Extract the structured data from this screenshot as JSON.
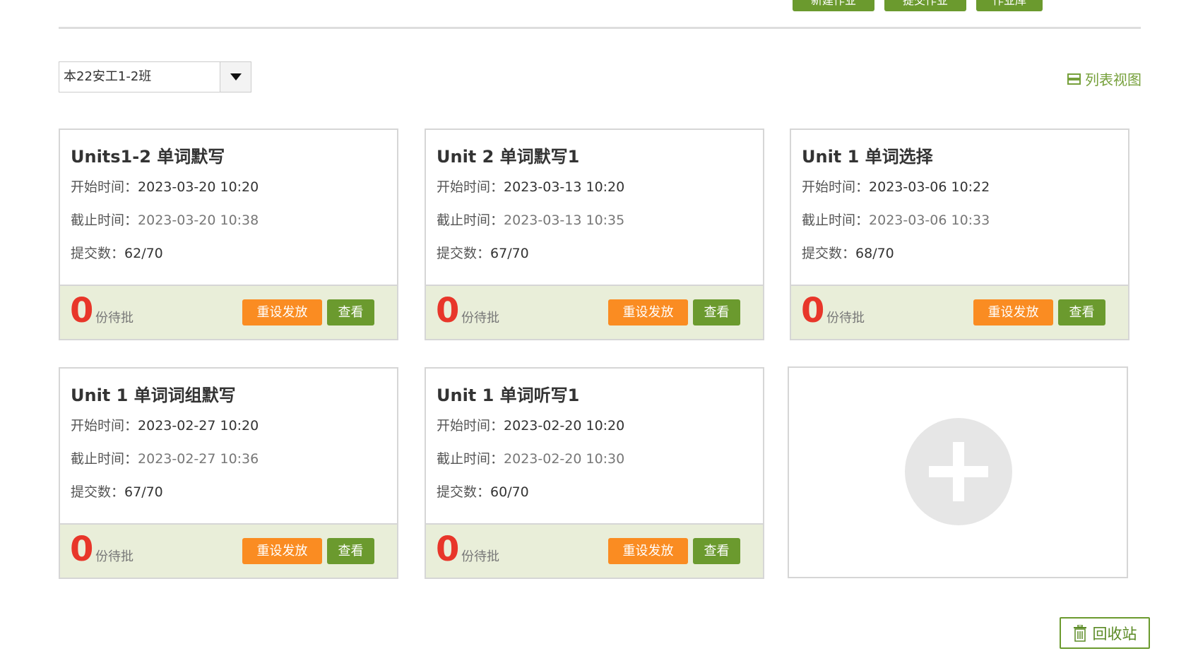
{
  "toolbar": {
    "buttons": [
      "新建作业",
      "提交作业",
      "作业库"
    ]
  },
  "class_select": {
    "value": "本22安工1-2班"
  },
  "view_toggle": {
    "label": "列表视图"
  },
  "card_labels": {
    "start": "开始时间：",
    "end": "截止时间：",
    "count": "提交数：",
    "pending": "份待批",
    "reissue": "重设发放",
    "view": "查看"
  },
  "cards": [
    {
      "title": "Units1-2 单词默写",
      "start": "2023-03-20 10:20",
      "end": "2023-03-20 10:38",
      "submitted": "62/70",
      "pending": "0"
    },
    {
      "title": "Unit 2 单词默写1",
      "start": "2023-03-13 10:20",
      "end": "2023-03-13 10:35",
      "submitted": "67/70",
      "pending": "0"
    },
    {
      "title": "Unit 1 单词选择",
      "start": "2023-03-06 10:22",
      "end": "2023-03-06 10:33",
      "submitted": "68/70",
      "pending": "0"
    },
    {
      "title": "Unit 1 单词词组默写",
      "start": "2023-02-27 10:20",
      "end": "2023-02-27 10:36",
      "submitted": "67/70",
      "pending": "0"
    },
    {
      "title": "Unit 1 单词听写1",
      "start": "2023-02-20 10:20",
      "end": "2023-02-20 10:30",
      "submitted": "60/70",
      "pending": "0"
    }
  ],
  "recycle": {
    "label": "回收站"
  },
  "colors": {
    "green": "#6b9a2e",
    "orange": "#fa8c22",
    "red": "#e8362a",
    "footer_bg": "#e9eed9"
  }
}
